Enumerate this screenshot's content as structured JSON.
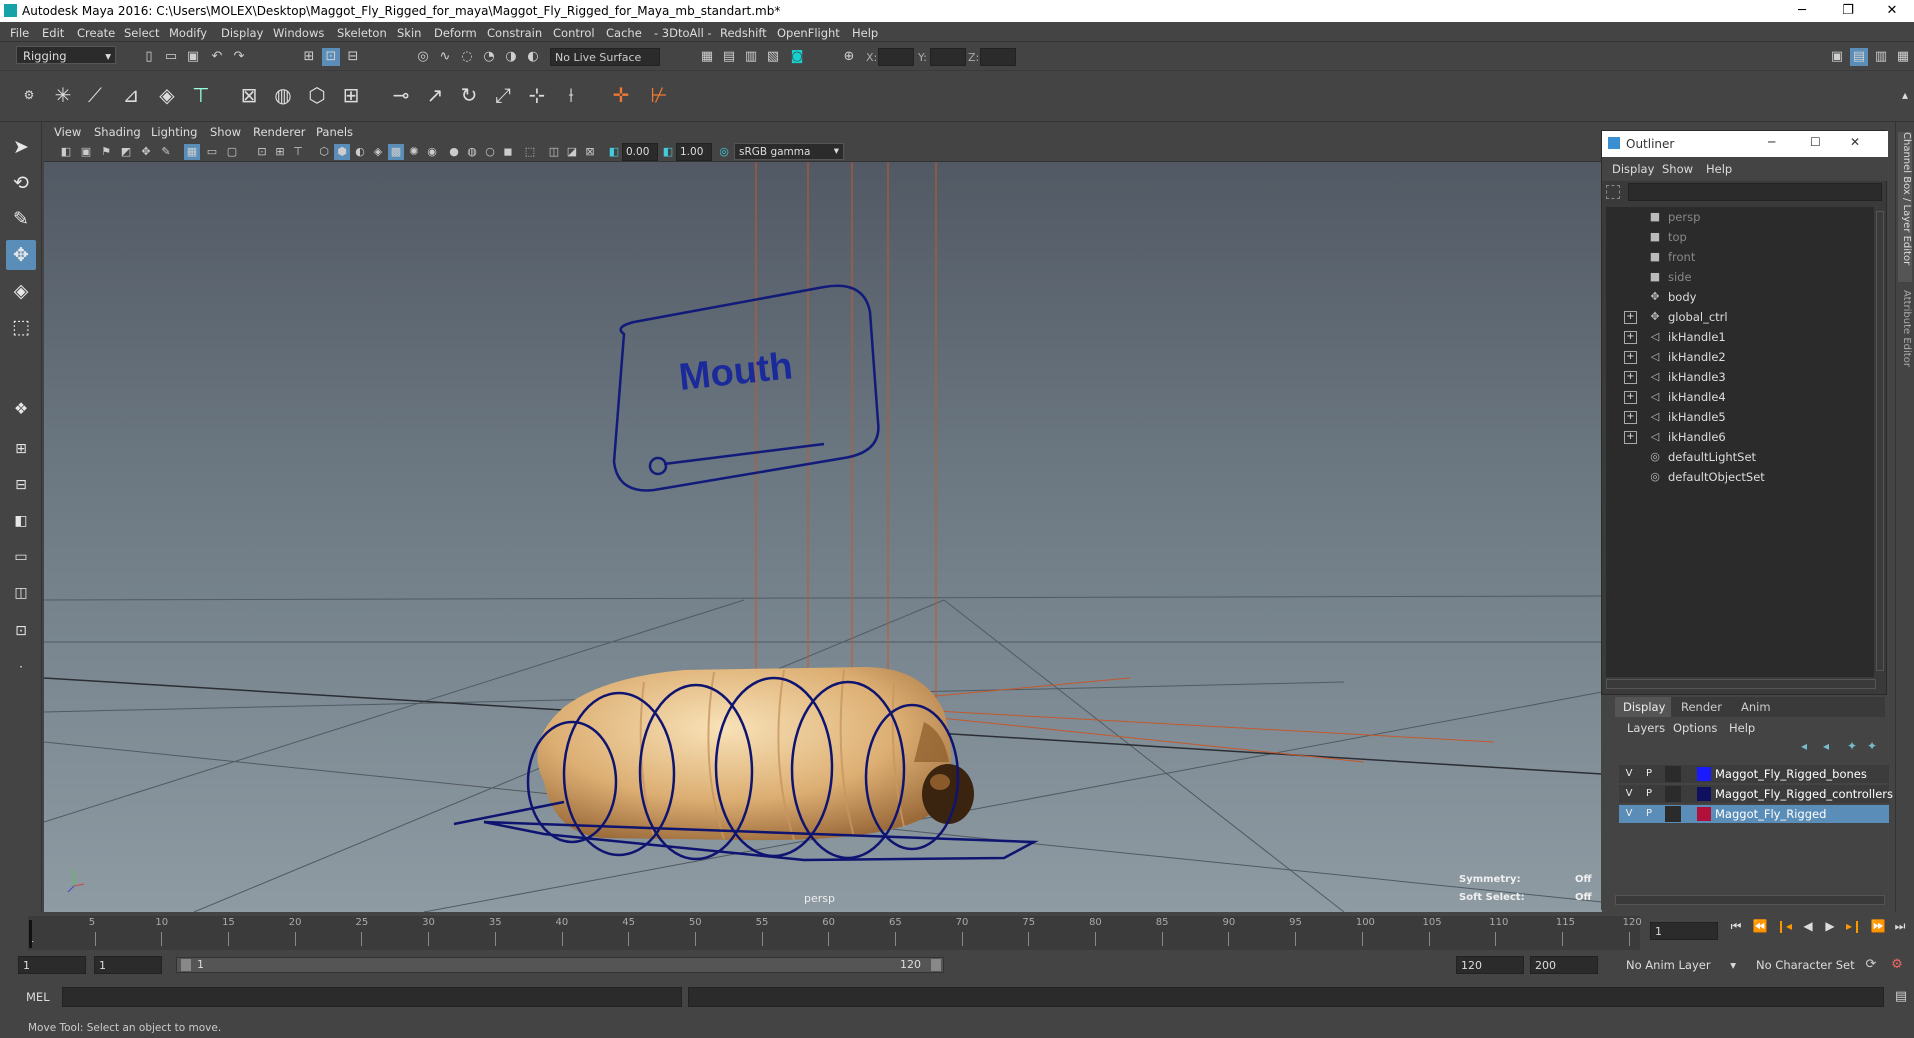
{
  "window": {
    "title": "Autodesk Maya 2016: C:\\Users\\MOLEX\\Desktop\\Maggot_Fly_Rigged_for_maya\\Maggot_Fly_Rigged_for_Maya_mb_standart.mb*",
    "minimize": "─",
    "restore": "❐",
    "close": "✕"
  },
  "menubar": [
    "File",
    "Edit",
    "Create",
    "Select",
    "Modify",
    "Display",
    "Windows",
    "Skeleton",
    "Skin",
    "Deform",
    "Constrain",
    "Control",
    "Cache",
    "- 3DtoAll -",
    "Redshift",
    "OpenFlight",
    "Help"
  ],
  "status": {
    "mode": "Rigging",
    "live_surface": "No Live Surface",
    "x_label": "X:",
    "y_label": "Y:",
    "z_label": "Z:"
  },
  "viewport": {
    "menu": [
      "View",
      "Shading",
      "Lighting",
      "Show",
      "Renderer",
      "Panels"
    ],
    "near": "0.00",
    "far": "1.00",
    "color_space": "sRGB gamma",
    "camera_label": "persp",
    "mouth_label": "Mouth",
    "symmetry_label": "Symmetry:",
    "symmetry_value": "Off",
    "soft_select_label": "Soft Select:",
    "soft_select_value": "Off"
  },
  "outliner": {
    "title": "Outliner",
    "menu": [
      "Display",
      "Show",
      "Help"
    ],
    "items": [
      {
        "label": "persp",
        "icon": "camera-icon",
        "dim": true,
        "expand": false
      },
      {
        "label": "top",
        "icon": "camera-icon",
        "dim": true,
        "expand": false
      },
      {
        "label": "front",
        "icon": "camera-icon",
        "dim": true,
        "expand": false
      },
      {
        "label": "side",
        "icon": "camera-icon",
        "dim": true,
        "expand": false
      },
      {
        "label": "body",
        "icon": "transform-icon",
        "dim": false,
        "expand": false
      },
      {
        "label": "global_ctrl",
        "icon": "transform-icon",
        "dim": false,
        "expand": true
      },
      {
        "label": "ikHandle1",
        "icon": "ik-handle-icon",
        "dim": false,
        "expand": true
      },
      {
        "label": "ikHandle2",
        "icon": "ik-handle-icon",
        "dim": false,
        "expand": true
      },
      {
        "label": "ikHandle3",
        "icon": "ik-handle-icon",
        "dim": false,
        "expand": true
      },
      {
        "label": "ikHandle4",
        "icon": "ik-handle-icon",
        "dim": false,
        "expand": true
      },
      {
        "label": "ikHandle5",
        "icon": "ik-handle-icon",
        "dim": false,
        "expand": true
      },
      {
        "label": "ikHandle6",
        "icon": "ik-handle-icon",
        "dim": false,
        "expand": true
      },
      {
        "label": "defaultLightSet",
        "icon": "set-icon",
        "dim": false,
        "expand": false
      },
      {
        "label": "defaultObjectSet",
        "icon": "set-icon",
        "dim": false,
        "expand": false
      }
    ]
  },
  "layers": {
    "tabs": [
      "Display",
      "Render",
      "Anim"
    ],
    "menu": [
      "Layers",
      "Options",
      "Help"
    ],
    "rows": [
      {
        "v": "V",
        "p": "P",
        "color": "#1a1aff",
        "name": "Maggot_Fly_Rigged_bones",
        "selected": false
      },
      {
        "v": "V",
        "p": "P",
        "color": "#101060",
        "name": "Maggot_Fly_Rigged_controllers",
        "selected": false
      },
      {
        "v": "V",
        "p": "P",
        "color": "#b0103a",
        "name": "Maggot_Fly_Rigged",
        "selected": true
      }
    ]
  },
  "side_tabs": {
    "channel_box": "Channel Box / Layer Editor",
    "attribute_editor": "Attribute Editor"
  },
  "timeline": {
    "ticks": [
      "5",
      "10",
      "15",
      "20",
      "25",
      "30",
      "35",
      "40",
      "45",
      "50",
      "55",
      "60",
      "65",
      "70",
      "75",
      "80",
      "85",
      "90",
      "95",
      "100",
      "105",
      "110",
      "115",
      "120"
    ],
    "start_label": "1",
    "current_frame": "1"
  },
  "range": {
    "start": "1",
    "anim_start": "1",
    "slider_start": "1",
    "slider_end": "120",
    "end": "120",
    "anim_end": "200",
    "anim_layer": "No Anim Layer",
    "char_set": "No Character Set"
  },
  "command": {
    "label": "MEL"
  },
  "help_line": "Move Tool: Select an object to move."
}
